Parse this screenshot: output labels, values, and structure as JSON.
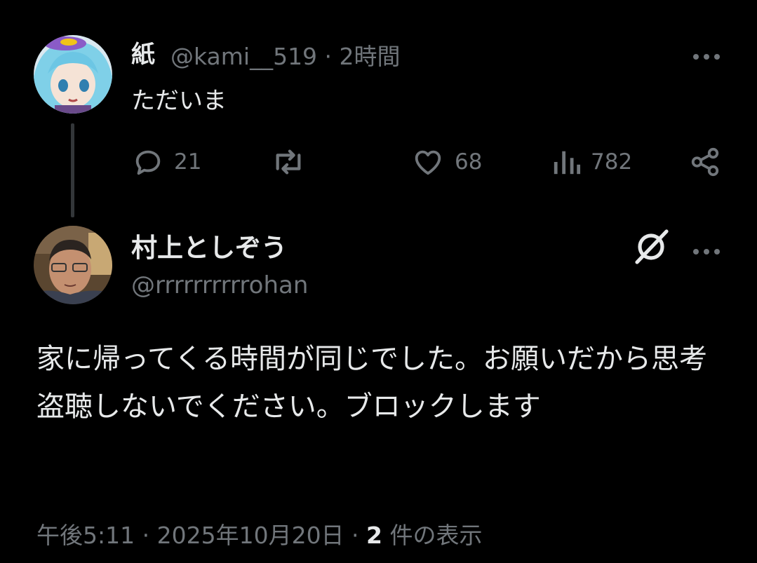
{
  "parent_post": {
    "display_name": "紙",
    "handle": "@kami__519",
    "time_sep": " · ",
    "time": "2時間",
    "text": "ただいま",
    "more_icon": "more-horizontal-icon",
    "actions": {
      "reply": {
        "icon": "reply-icon",
        "count": "21"
      },
      "repost": {
        "icon": "repost-icon",
        "count": ""
      },
      "like": {
        "icon": "heart-icon",
        "count": "68"
      },
      "views": {
        "icon": "views-icon",
        "count": "782"
      },
      "share": {
        "icon": "share-icon"
      }
    }
  },
  "main_post": {
    "display_name": "村上としぞう",
    "handle": "@rrrrrrrrrrohan",
    "grok_icon": "grok-icon",
    "more_icon": "more-horizontal-icon",
    "text": "家に帰ってくる時間が同じでした。お願いだから思考盗聴しないでください。ブロックします",
    "footer": {
      "time": "午後5:11",
      "sep1": " · ",
      "date": "2025年10月20日",
      "sep2": " · ",
      "quote_count": "2",
      "quote_label": " 件の表示"
    }
  },
  "colors": {
    "background": "#000000",
    "primary_text": "#e7e9ea",
    "secondary_text": "#71767b",
    "thread_line": "#333639"
  }
}
